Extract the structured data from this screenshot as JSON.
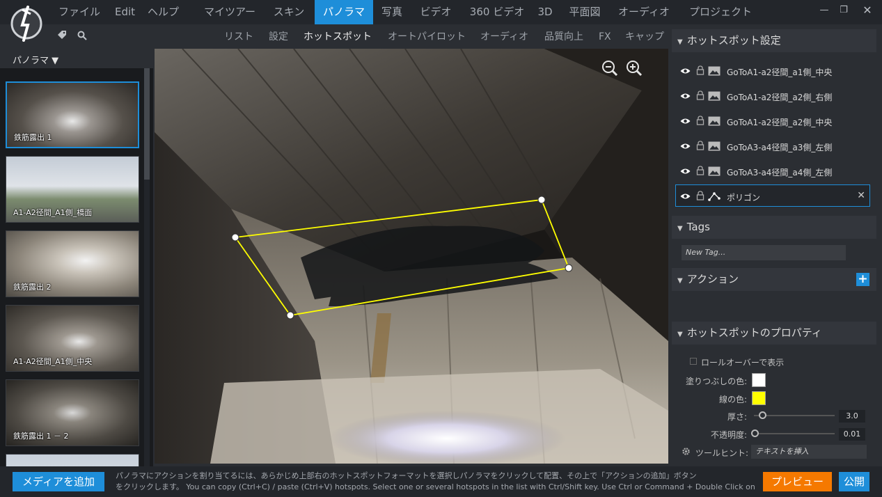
{
  "menu": {
    "file": "ファイル",
    "edit": "Edit",
    "help": "ヘルプ"
  },
  "main_tabs": [
    "マイツアー",
    "スキン",
    "パノラマ",
    "写真",
    "ビデオ",
    "360 ビデオ",
    "3D",
    "平面図",
    "オーディオ",
    "プロジェクト"
  ],
  "active_main_tab": "パノラマ",
  "sub_tabs": [
    "リスト",
    "設定",
    "ホットスポット",
    "オートパイロット",
    "オーディオ",
    "品質向上",
    "FX",
    "キャップ"
  ],
  "active_sub_tab": "ホットスポット",
  "left": {
    "dropdown_label": "パノラマ ▼",
    "thumbnails": [
      {
        "caption": "鉄筋露出 1"
      },
      {
        "caption": "A1-A2径間_A1側_橋面"
      },
      {
        "caption": "鉄筋露出 2"
      },
      {
        "caption": "A1-A2径間_A1側_中央"
      },
      {
        "caption": "鉄筋露出 1 － 2"
      },
      {
        "caption": ""
      }
    ]
  },
  "right": {
    "hotspot_settings_title": "ホットスポット設定",
    "hotspots": [
      {
        "label": "GoToA1-a2径間_a1側_中央",
        "type": "image"
      },
      {
        "label": "GoToA1-a2径間_a2側_右側",
        "type": "image"
      },
      {
        "label": "GoToA1-a2径間_a2側_中央",
        "type": "image"
      },
      {
        "label": "GoToA3-a4径間_a3側_左側",
        "type": "image"
      },
      {
        "label": "GoToA3-a4径間_a4側_左側",
        "type": "image"
      },
      {
        "label": "ポリゴン",
        "type": "polygon",
        "close": "✕"
      }
    ],
    "tags_title": "Tags",
    "tag_placeholder": "New Tag...",
    "actions_title": "アクション",
    "add_action": "+",
    "props_title": "ホットスポットのプロパティ",
    "rollover_label": "ロールオーバーで表示",
    "fill_color_label": "塗りつぶしの色:",
    "fill_color": "#ffffff",
    "line_color_label": "線の色:",
    "line_color": "#ffff00",
    "thickness_label": "厚さ:",
    "thickness_value": "3.0",
    "opacity_label": "不透明度:",
    "opacity_value": "0.01",
    "tooltip_label": "ツールヒント:",
    "tooltip_placeholder": "テキストを挿入"
  },
  "bottom": {
    "add_media": "メディアを追加",
    "hint_line1": "パノラマにアクションを割り当てるには、あらかじめ上部右のホットスポットフォーマットを選択しパノラマをクリックして配置、その上で「アクションの追加」ボタン",
    "hint_line2": "をクリックします。 You can copy (Ctrl+C) / paste (Ctrl+V) hotspots. Select one or several hotspots in the list with Ctrl/Shift key. Use Ctrl or Command + Double Click on a ...",
    "preview": "プレビュー",
    "publish": "公開"
  },
  "colors": {
    "accent": "#1e8ed9",
    "preview": "#f57900",
    "polygon": "#ffff00"
  }
}
